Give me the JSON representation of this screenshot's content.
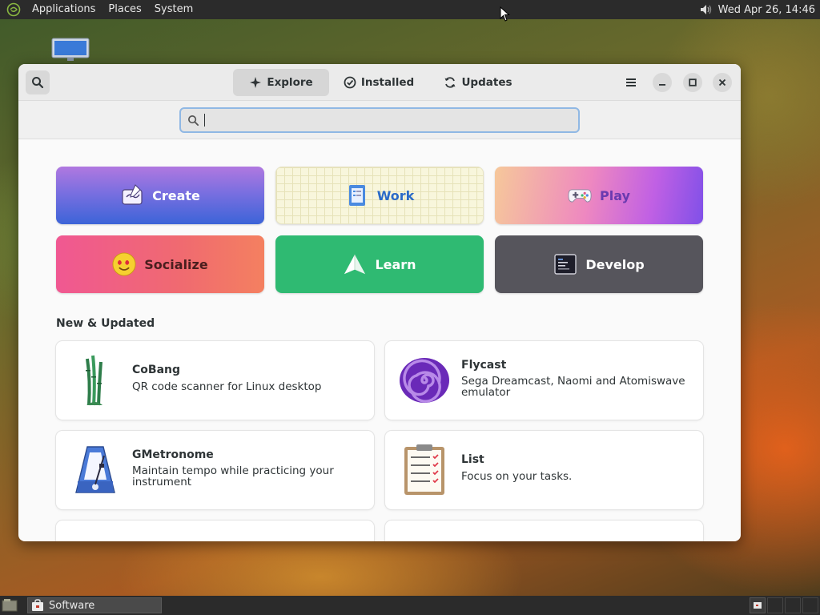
{
  "top_panel": {
    "menus": [
      "Applications",
      "Places",
      "System"
    ],
    "clock": "Wed Apr 26, 14:46"
  },
  "window": {
    "tabs": [
      {
        "label": "Explore",
        "icon": "compass-icon",
        "active": true
      },
      {
        "label": "Installed",
        "icon": "check-circle-icon",
        "active": false
      },
      {
        "label": "Updates",
        "icon": "refresh-icon",
        "active": false
      }
    ],
    "search": {
      "value": "",
      "placeholder": ""
    },
    "categories": [
      {
        "label": "Create",
        "icon": "create-icon"
      },
      {
        "label": "Work",
        "icon": "work-icon"
      },
      {
        "label": "Play",
        "icon": "gamepad-icon"
      },
      {
        "label": "Socialize",
        "icon": "smiley-icon"
      },
      {
        "label": "Learn",
        "icon": "paper-plane-icon"
      },
      {
        "label": "Develop",
        "icon": "terminal-icon"
      }
    ],
    "section_title": "New & Updated",
    "apps": [
      {
        "name": "CoBang",
        "description": "QR code scanner for Linux desktop",
        "icon": "bamboo-icon"
      },
      {
        "name": "Flycast",
        "description": "Sega Dreamcast, Naomi and Atomiswave emulator",
        "icon": "spiral-icon"
      },
      {
        "name": "GMetronome",
        "description": "Maintain tempo while practicing your instrument",
        "icon": "metronome-icon"
      },
      {
        "name": "List",
        "description": "Focus on your tasks.",
        "icon": "checklist-icon"
      }
    ]
  },
  "bottom_panel": {
    "task_label": "Software"
  },
  "colors": {
    "panel": "#2b2b2b",
    "accent_focus": "#90b8e4",
    "work_text": "#2a6ac8",
    "learn": "#2fba72",
    "develop": "#56555c"
  }
}
